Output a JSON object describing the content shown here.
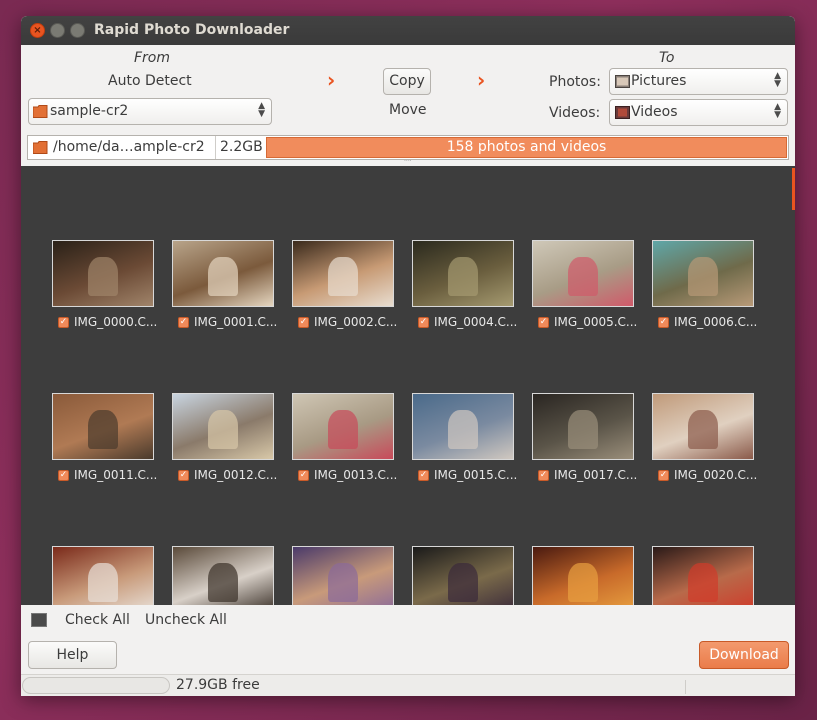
{
  "window": {
    "title": "Rapid Photo Downloader"
  },
  "source": {
    "heading": "From",
    "mode": "Auto Detect",
    "device": "sample-cr2"
  },
  "transfer": {
    "copy_label": "Copy",
    "move_label": "Move"
  },
  "destination": {
    "heading": "To",
    "photos_label": "Photos:",
    "photos_value": "Pictures",
    "videos_label": "Videos:",
    "videos_value": "Videos"
  },
  "pathbar": {
    "path": "/home/da…ample-cr2",
    "size": "2.2GB",
    "progress_text": "158 photos and videos",
    "progress_fraction": 1.0
  },
  "thumbnails": [
    {
      "name": "IMG_0000.C...",
      "checked": true,
      "colors": [
        "#2a2118",
        "#6b4a35",
        "#a0846a"
      ]
    },
    {
      "name": "IMG_0001.C...",
      "checked": true,
      "colors": [
        "#b8a48a",
        "#7b5a3c",
        "#e5d6c0"
      ]
    },
    {
      "name": "IMG_0002.C...",
      "checked": true,
      "colors": [
        "#3a2a1c",
        "#c79a74",
        "#e8ddd0"
      ]
    },
    {
      "name": "IMG_0004.C...",
      "checked": true,
      "colors": [
        "#2b2a1e",
        "#6a5e3e",
        "#a59a70"
      ]
    },
    {
      "name": "IMG_0005.C...",
      "checked": true,
      "colors": [
        "#cfc8b8",
        "#a89c86",
        "#d05a6a"
      ]
    },
    {
      "name": "IMG_0006.C...",
      "checked": true,
      "colors": [
        "#5fa7a8",
        "#6f6a4a",
        "#b89a78"
      ]
    },
    {
      "name": "IMG_0011.C...",
      "checked": true,
      "colors": [
        "#8a5a3a",
        "#b07a54",
        "#4a3a2c"
      ]
    },
    {
      "name": "IMG_0012.C...",
      "checked": true,
      "colors": [
        "#c8d4e0",
        "#8a7a6a",
        "#d8c8a8"
      ]
    },
    {
      "name": "IMG_0013.C...",
      "checked": true,
      "colors": [
        "#cfc6b4",
        "#a89a84",
        "#c84a5a"
      ]
    },
    {
      "name": "IMG_0015.C...",
      "checked": true,
      "colors": [
        "#4a6a8a",
        "#7a8aa0",
        "#d0c8c0"
      ]
    },
    {
      "name": "IMG_0017.C...",
      "checked": true,
      "colors": [
        "#2a2622",
        "#5a5448",
        "#9a8e7a"
      ]
    },
    {
      "name": "IMG_0020.C...",
      "checked": true,
      "colors": [
        "#c09a7a",
        "#e0d0c0",
        "#8a5a4a"
      ]
    },
    {
      "name": "",
      "checked": false,
      "colors": [
        "#7a2a1a",
        "#c89a7a",
        "#e8e0d8"
      ]
    },
    {
      "name": "",
      "checked": false,
      "colors": [
        "#5a4a3a",
        "#d8d0c8",
        "#3a3028"
      ]
    },
    {
      "name": "",
      "checked": false,
      "colors": [
        "#4a3a6a",
        "#c89a7a",
        "#8a6a9a"
      ]
    },
    {
      "name": "",
      "checked": false,
      "colors": [
        "#1a1a1a",
        "#7a6a4a",
        "#3a2a3a"
      ]
    },
    {
      "name": "",
      "checked": false,
      "colors": [
        "#4a1a10",
        "#c86a2a",
        "#e8a040"
      ]
    },
    {
      "name": "",
      "checked": false,
      "colors": [
        "#2a1a18",
        "#b86a4a",
        "#d03a2a"
      ]
    }
  ],
  "footer": {
    "check_all": "Check All",
    "uncheck_all": "Uncheck All",
    "help": "Help",
    "download": "Download",
    "free_space": "27.9GB free"
  },
  "colors": {
    "accent": "#e95420",
    "grid_bg": "#3d3d3d"
  }
}
